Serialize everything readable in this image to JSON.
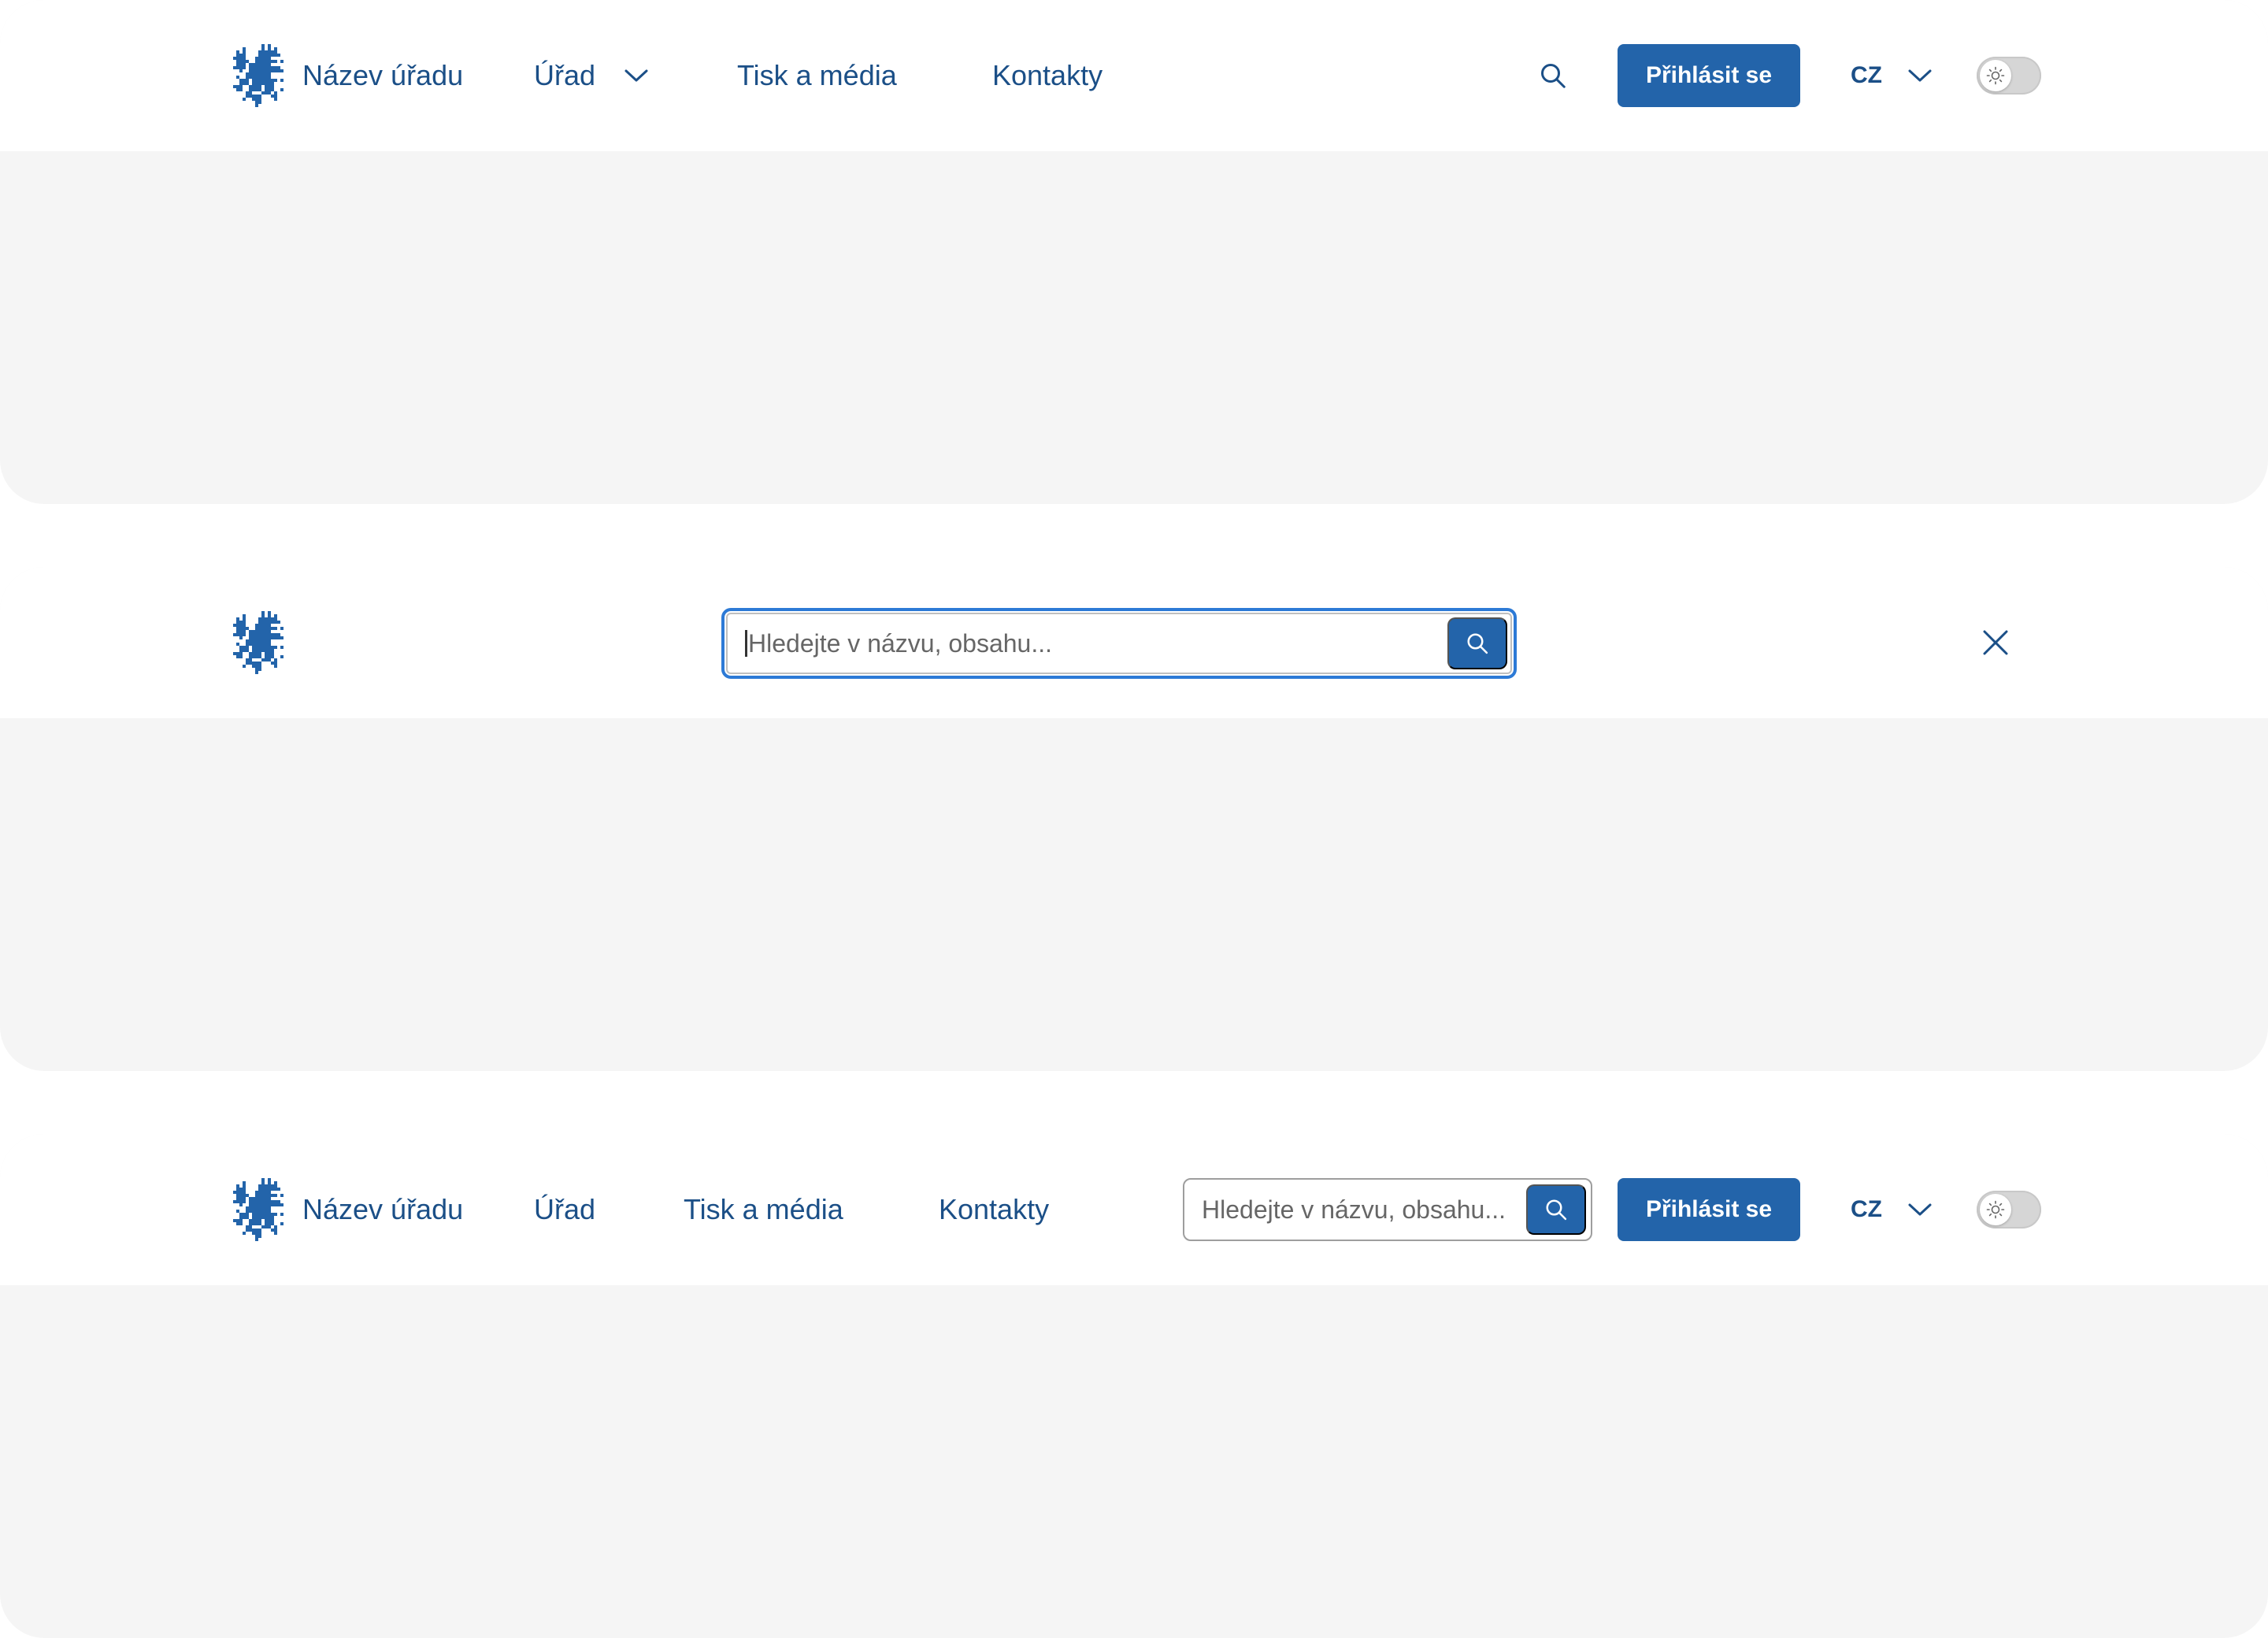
{
  "variant_default": {
    "brand": "Název úřadu",
    "nav": [
      "Úřad",
      "Tisk a média",
      "Kontakty"
    ],
    "login_label": "Přihlásit se",
    "language": "CZ"
  },
  "variant_search_open": {
    "search_placeholder": "Hledejte v názvu, obsahu..."
  },
  "variant_inline_search": {
    "brand": "Název úřadu",
    "nav": [
      "Úřad",
      "Tisk a média",
      "Kontakty"
    ],
    "search_placeholder": "Hledejte v názvu, obsahu...",
    "login_label": "Přihlásit se",
    "language": "CZ"
  },
  "icons": {
    "logo": "heraldic-lion-icon",
    "search": "search-icon",
    "chevron": "chevron-down-icon",
    "close": "close-icon",
    "theme": "sun-icon"
  },
  "colors": {
    "brand_text": "#1b4f87",
    "primary": "#2364aa",
    "focus_ring": "#2d7ad6",
    "content_bg": "#f5f5f5",
    "header_bg": "#ffffff"
  }
}
